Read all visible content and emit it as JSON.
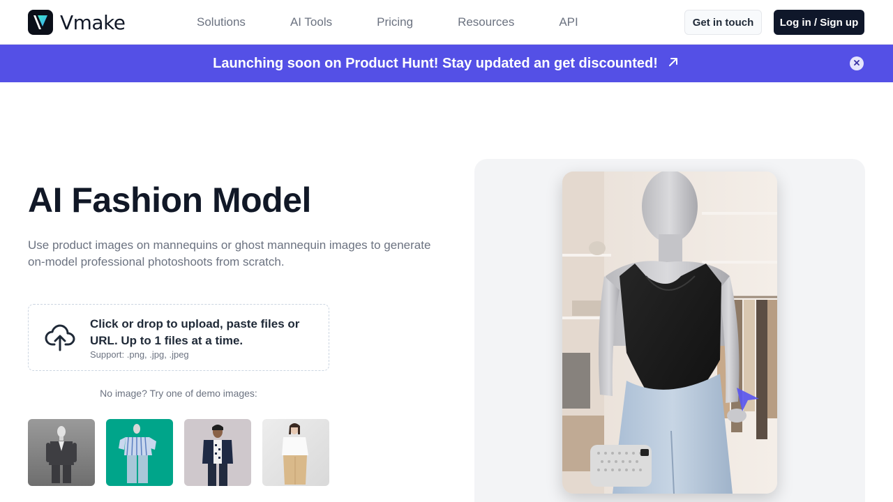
{
  "brand": {
    "name": "Vmake"
  },
  "nav": {
    "links": [
      "Solutions",
      "AI Tools",
      "Pricing",
      "Resources",
      "API"
    ],
    "get_in_touch": "Get in touch",
    "login": "Log in / Sign up"
  },
  "banner": {
    "text": "Launching soon on Product Hunt! Stay updated an get discounted!",
    "link_icon": "arrow-up-right-icon",
    "close_icon": "close-icon"
  },
  "hero": {
    "title": "AI Fashion Model",
    "description": "Use product images on mannequins or ghost mannequin images to generate on-model professional photoshoots from scratch."
  },
  "upload": {
    "icon": "cloud-upload-icon",
    "main_text": "Click or drop to upload, paste files or URL. Up to 1 files at a time.",
    "support_text": "Support: .png, .jpg, .jpeg"
  },
  "demo": {
    "label": "No image? Try one of demo images:",
    "images": [
      {
        "name": "mannequin in grey suit",
        "background": "#8a8a8a"
      },
      {
        "name": "mannequin in striped shirt",
        "background": "#00a58a"
      },
      {
        "name": "man in navy jacket",
        "background": "#cfc8cc"
      },
      {
        "name": "woman in white blouse",
        "background": "#e6e6e6"
      }
    ]
  },
  "preview": {
    "subject": "mannequin wearing black top and jeans in boutique",
    "cursor_icon": "cursor-pointer-icon"
  },
  "colors": {
    "accent": "#5450e6",
    "dark": "#0f172a",
    "text_muted": "#6b7280"
  }
}
